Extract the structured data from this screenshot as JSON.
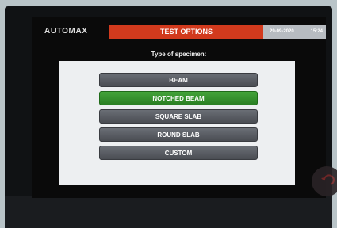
{
  "header": {
    "brand": "AUTOMAX",
    "title": "TEST OPTIONS",
    "date": "29-09-2020",
    "time": "15:24"
  },
  "prompt": "Type of specimen:",
  "options": [
    {
      "label": "BEAM",
      "selected": false
    },
    {
      "label": "NOTCHED BEAM",
      "selected": true
    },
    {
      "label": "SQUARE SLAB",
      "selected": false
    },
    {
      "label": "ROUND SLAB",
      "selected": false
    },
    {
      "label": "CUSTOM",
      "selected": false
    }
  ],
  "colors": {
    "title_bar": "#d23a1d",
    "selected": "#2a7f23",
    "button": "#55585e"
  },
  "icons": {
    "back": "back-arrow-icon"
  }
}
